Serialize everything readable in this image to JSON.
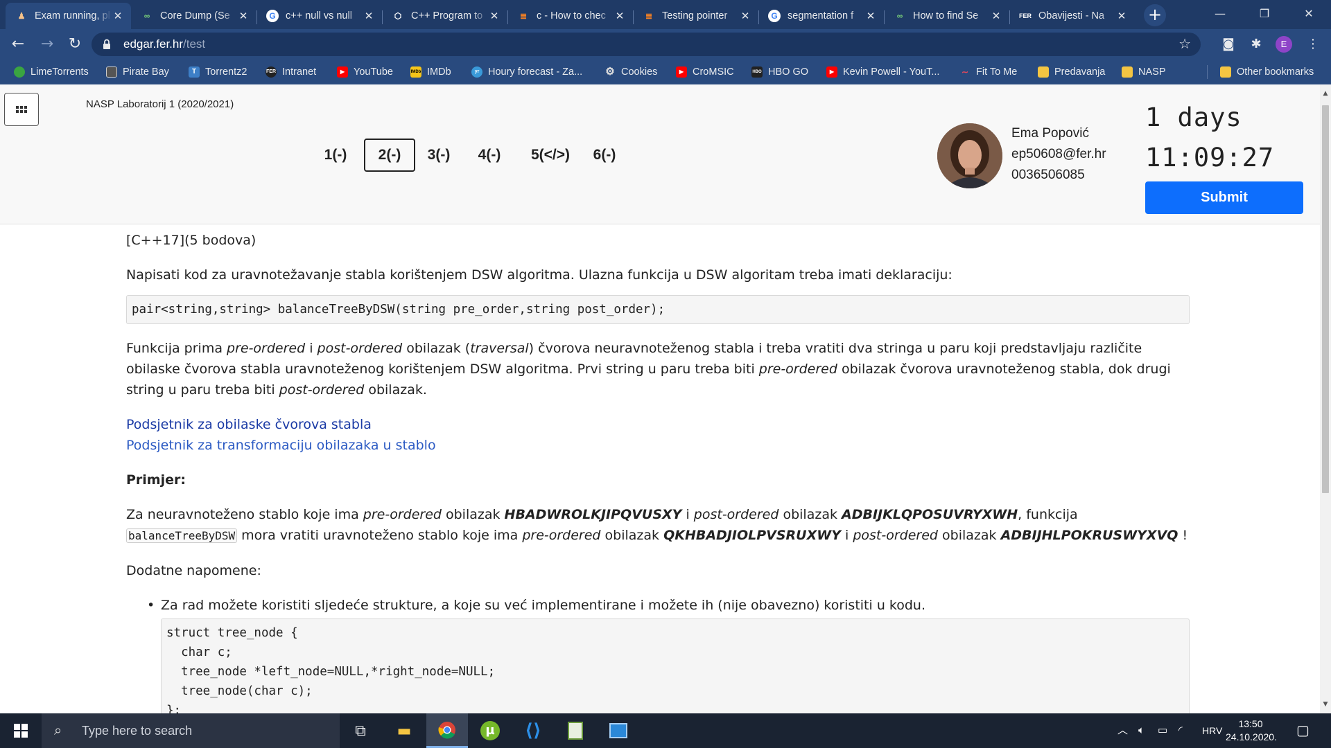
{
  "browser": {
    "tabs": [
      {
        "title": "Exam running, pl",
        "icon": "runner-icon"
      },
      {
        "title": "Core Dump (Se",
        "icon": "github-icon"
      },
      {
        "title": "c++ null vs null",
        "icon": "google-icon"
      },
      {
        "title": "C++ Program to",
        "icon": "gear-icon"
      },
      {
        "title": "c - How to chec",
        "icon": "stackoverflow-icon"
      },
      {
        "title": "Testing pointer",
        "icon": "stackoverflow-icon"
      },
      {
        "title": "segmentation f",
        "icon": "google-icon"
      },
      {
        "title": "How to find Se",
        "icon": "github-icon"
      },
      {
        "title": "Obavijesti - Na",
        "icon": "ferweb-icon"
      }
    ],
    "url_host": "edgar.fer.hr",
    "url_path": "/test",
    "profile_initial": "E",
    "bookmarks": [
      {
        "label": "LimeTorrents",
        "color": "#3aa541"
      },
      {
        "label": "Pirate Bay",
        "color": "#555555"
      },
      {
        "label": "Torrentz2",
        "color": "#3d7fc7"
      },
      {
        "label": "Intranet",
        "color": "#222222"
      },
      {
        "label": "YouTube",
        "color": "#ff0000"
      },
      {
        "label": "IMDb",
        "color": "#f5c518"
      },
      {
        "label": "Houry forecast - Za...",
        "color": "#3a9ad9"
      },
      {
        "label": "Cookies",
        "color": "#dddddd"
      },
      {
        "label": "CroMSIC",
        "color": "#ff0000"
      },
      {
        "label": "HBO GO",
        "color": "#222222"
      },
      {
        "label": "Kevin Powell - YouT...",
        "color": "#ff0000"
      },
      {
        "label": "Fit To Me",
        "color": "#e0475b"
      },
      {
        "label": "Predavanja",
        "color": "#f4c542"
      },
      {
        "label": "NASP",
        "color": "#f4c542"
      },
      {
        "label": "Other bookmarks",
        "color": "#f4c542"
      }
    ]
  },
  "header": {
    "course": "NASP Laboratorij 1 (2020/2021)",
    "questions": [
      "1(-)",
      "2(-)",
      "3(-)",
      "4(-)",
      "5(</>)",
      "6(-)"
    ],
    "current_question": "2(-)",
    "user": {
      "name": "Ema Popović",
      "email": "ep50608@fer.hr",
      "id": "0036506085"
    },
    "timer_days": "1 days",
    "timer_clock": "11:09:27",
    "submit_label": "Submit"
  },
  "content": {
    "tag": "[C++17](5 bodova)",
    "intro": "Napisati kod za uravnotežavanje stabla korištenjem DSW algoritma. Ulazna funkcija u DSW algoritam treba imati deklaraciju:",
    "declaration": "pair<string,string> balanceTreeByDSW(string pre_order,string post_order);",
    "desc_1": "Funkcija prima ",
    "desc_pre": "pre-ordered",
    "desc_2": " i ",
    "desc_post": "post-ordered",
    "desc_3": " obilazak (",
    "desc_trav": "traversal",
    "desc_4": ") čvorova neuravnoteženog stabla i treba vratiti dva stringa u paru koji predstavljaju različite obilaske čvorova stabla uravnoteženog korištenjem DSW algoritma. Prvi string u paru treba biti ",
    "desc_5": " obilazak čvorova uravnoteženog stabla, dok drugi string u paru treba biti ",
    "desc_6": " obilazak.",
    "link_1": "Podsjetnik za obilaske čvorova stabla",
    "link_2": "Podsjetnik za transformaciju obilazaka u stablo",
    "example_heading": "Primjer:",
    "ex_1": "Za neuravnoteženo stablo koje ima ",
    "ex_2": " obilazak ",
    "ex_pre_in": "HBADWROLKJIPQVUSXY",
    "ex_3": " i ",
    "ex_post_in": "ADBIJKLQPOSUVRYXWH",
    "ex_4": ", funkcija ",
    "ex_fn": "balanceTreeByDSW",
    "ex_5": " mora vratiti uravnoteženo stablo koje ima ",
    "ex_pre_out": "QKHBADJIOLPVSRUXWY",
    "ex_post_out": "ADBIJHLPOKRUSWYXVQ",
    "ex_6": " !",
    "notes_heading": "Dodatne napomene:",
    "note_1": "Za rad možete koristiti sljedeće strukture, a koje su već implementirane i možete ih (nije obavezno) koristiti u kodu.",
    "struct_lines": [
      "struct tree_node {",
      "  char c;",
      "  tree_node *left_node=NULL,*right_node=NULL;",
      "  tree_node(char c);",
      "};"
    ]
  },
  "taskbar": {
    "search_placeholder": "Type here to search",
    "lang": "HRV",
    "time": "13:50",
    "date": "24.10.2020."
  }
}
